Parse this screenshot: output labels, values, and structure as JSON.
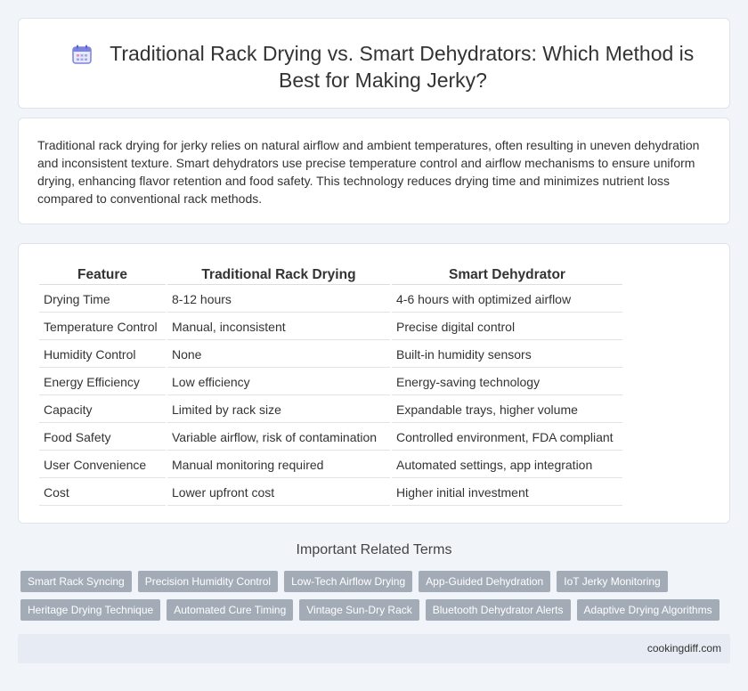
{
  "header": {
    "title": "Traditional Rack Drying vs. Smart Dehydrators: Which Method is Best for Making Jerky?",
    "icon": "calendar-icon",
    "icon_color": "#6b73d9"
  },
  "intro": {
    "text": "Traditional rack drying for jerky relies on natural airflow and ambient temperatures, often resulting in uneven dehydration and inconsistent texture. Smart dehydrators use precise temperature control and airflow mechanisms to ensure uniform drying, enhancing flavor retention and food safety. This technology reduces drying time and minimizes nutrient loss compared to conventional rack methods."
  },
  "comparison_table": {
    "headers": [
      "Feature",
      "Traditional Rack Drying",
      "Smart Dehydrator"
    ],
    "rows": [
      [
        "Drying Time",
        "8-12 hours",
        "4-6 hours with optimized airflow"
      ],
      [
        "Temperature Control",
        "Manual, inconsistent",
        "Precise digital control"
      ],
      [
        "Humidity Control",
        "None",
        "Built-in humidity sensors"
      ],
      [
        "Energy Efficiency",
        "Low efficiency",
        "Energy-saving technology"
      ],
      [
        "Capacity",
        "Limited by rack size",
        "Expandable trays, higher volume"
      ],
      [
        "Food Safety",
        "Variable airflow, risk of contamination",
        "Controlled environment, FDA compliant"
      ],
      [
        "User Convenience",
        "Manual monitoring required",
        "Automated settings, app integration"
      ],
      [
        "Cost",
        "Lower upfront cost",
        "Higher initial investment"
      ]
    ]
  },
  "related": {
    "heading": "Important Related Terms",
    "tag_rows": [
      [
        "Smart Rack Syncing",
        "Precision Humidity Control",
        "Low-Tech Airflow Drying",
        "App-Guided Dehydration",
        "IoT Jerky Monitoring"
      ],
      [
        "Heritage Drying Technique",
        "Automated Cure Timing",
        "Vintage Sun-Dry Rack",
        "Bluetooth Dehydrator Alerts",
        "Adaptive Drying Algorithms"
      ]
    ],
    "tag_color": "#a3acb6"
  },
  "footer": {
    "site": "cookingdiff.com"
  }
}
